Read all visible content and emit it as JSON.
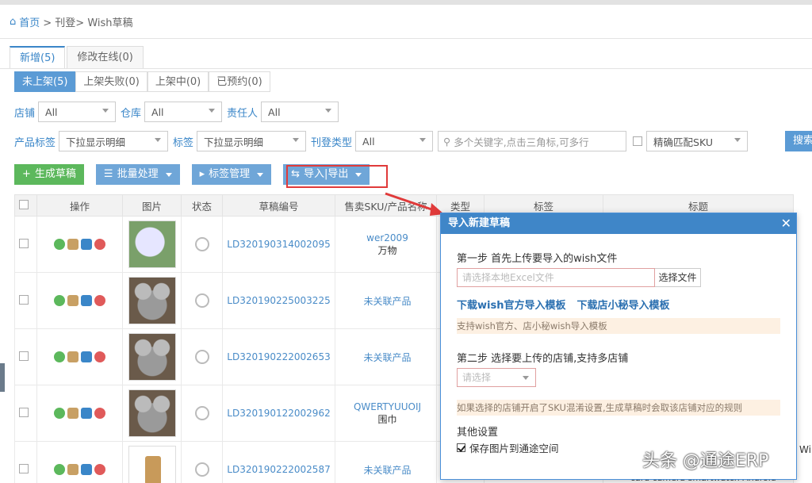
{
  "breadcrumb": {
    "home": "首页",
    "path": "> 刊登> Wish草稿"
  },
  "tabs": [
    "新增(5)",
    "修改在线(0)"
  ],
  "subtabs": [
    "未上架(5)",
    "上架失败(0)",
    "上架中(0)",
    "已预约(0)"
  ],
  "filters": {
    "shop_label": "店铺",
    "shop_value": "All",
    "warehouse_label": "仓库",
    "warehouse_value": "All",
    "owner_label": "责任人",
    "owner_value": "All",
    "tag_label": "产品标签",
    "tag_value": "下拉显示明细",
    "tag2_label": "标签",
    "tag2_value": "下拉显示明细",
    "type_label": "刊登类型",
    "type_value": "All",
    "search_placeholder": "多个关键字,点击三角标,可多行",
    "exact_label": "精确匹配SKU",
    "search_btn": "搜索"
  },
  "actions": {
    "create": "生成草稿",
    "batch": "批量处理",
    "tags": "标签管理",
    "import": "导入|导出"
  },
  "table": {
    "headers": [
      "操作",
      "图片",
      "状态",
      "草稿编号",
      "售卖SKU/产品名称",
      "类型",
      "标签",
      "标题"
    ],
    "rows": [
      {
        "code": "LD320190314002095",
        "sku": "wer2009",
        "name": "万物",
        "img": "flower"
      },
      {
        "code": "LD320190225003225",
        "sku": "未关联产品",
        "name": "",
        "img": "koala"
      },
      {
        "code": "LD320190222002653",
        "sku": "未关联产品",
        "name": "",
        "img": "koala"
      },
      {
        "code": "LD320190122002962",
        "sku": "QWERTYUUOIJ",
        "name": "围巾",
        "img": "koala"
      },
      {
        "code": "LD320190222002587",
        "sku": "未关联产品",
        "name": "",
        "img": "watch"
      }
    ]
  },
  "dialog": {
    "title": "导入新建草稿",
    "step1": "第一步 首先上传要导入的wish文件",
    "file_placeholder": "请选择本地Excel文件",
    "file_btn": "选择文件",
    "link1": "下载wish官方导入模板",
    "link2": "下载店小秘导入模板",
    "tip1": "支持wish官方、店小秘wish导入模板",
    "step2": "第二步 选择要上传的店铺,支持多店铺",
    "shop_placeholder": "请选择",
    "tip2": "如果选择的店铺开启了SKU混淆设置,生成草稿时会取该店铺对应的规则",
    "other_title": "其他设置",
    "save_img": "保存图片到通途空间"
  },
  "watermark": "头条 @通途ERP",
  "peek_right": "Wi",
  "peek_bottom": "card camera smartwatch Android"
}
